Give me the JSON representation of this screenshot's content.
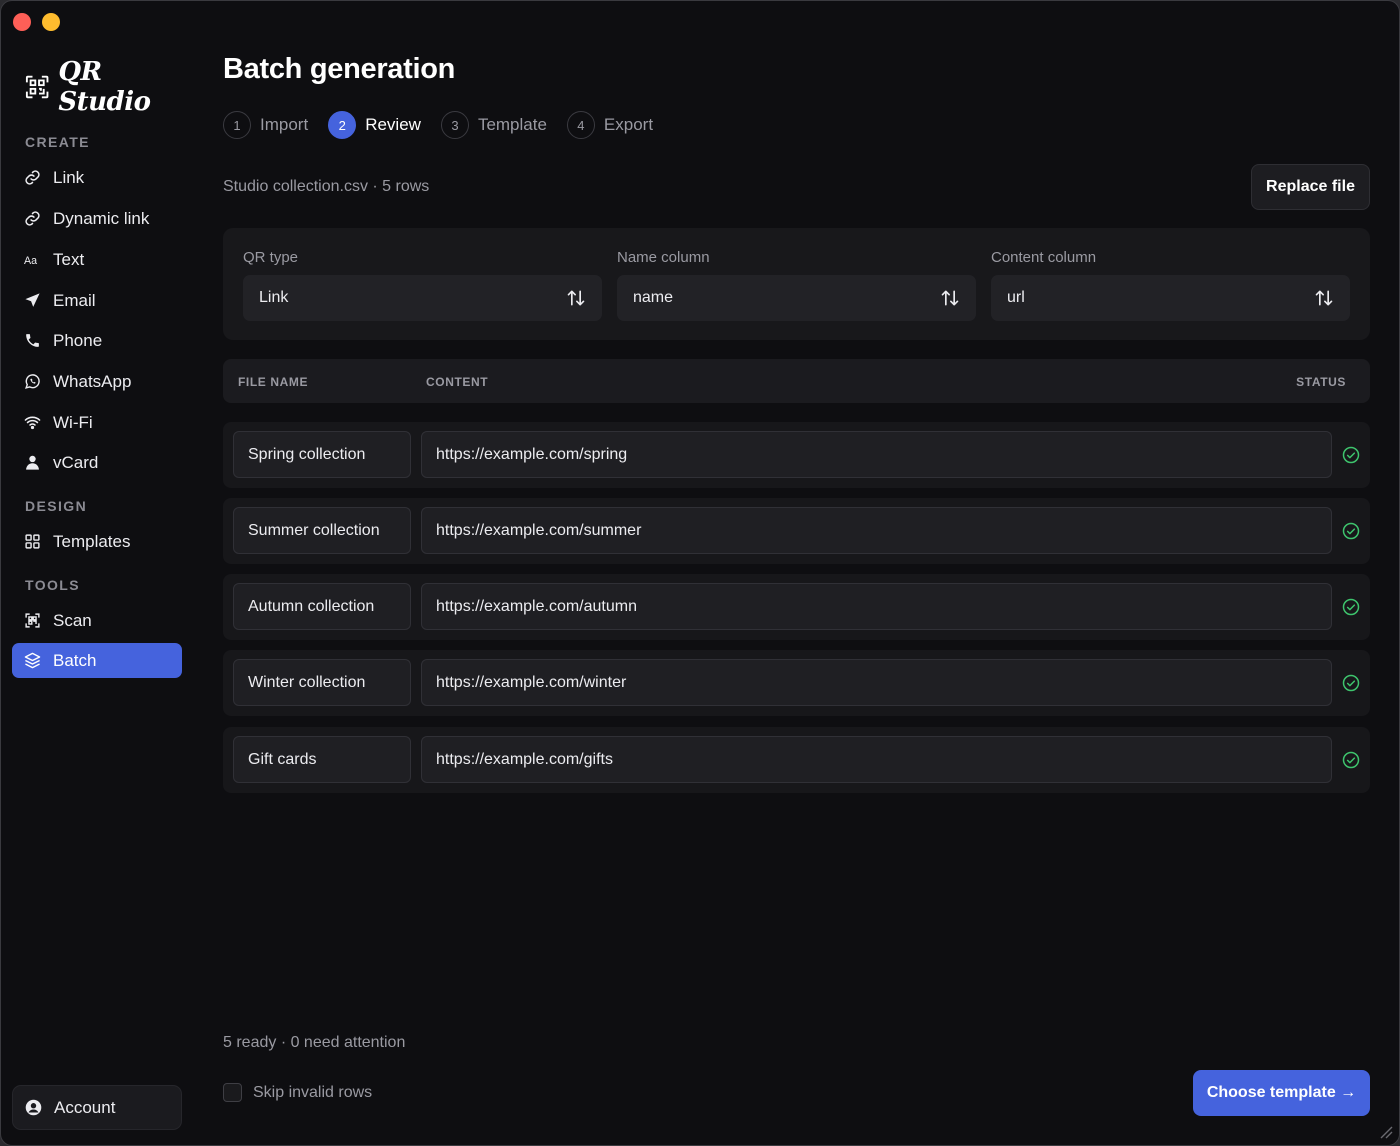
{
  "app": {
    "name": "QR Studio"
  },
  "sidebar": {
    "sections": {
      "create": "CREATE",
      "design": "DESIGN",
      "tools": "TOOLS"
    },
    "items": {
      "link": {
        "label": "Link",
        "icon": "link-icon"
      },
      "dynamic_link": {
        "label": "Dynamic link",
        "icon": "link-icon"
      },
      "text": {
        "label": "Text",
        "icon": "text-icon"
      },
      "email": {
        "label": "Email",
        "icon": "send-icon"
      },
      "phone": {
        "label": "Phone",
        "icon": "phone-icon"
      },
      "whatsapp": {
        "label": "WhatsApp",
        "icon": "whatsapp-icon"
      },
      "wifi": {
        "label": "Wi-Fi",
        "icon": "wifi-icon"
      },
      "vcard": {
        "label": "vCard",
        "icon": "user-icon"
      },
      "templates": {
        "label": "Templates",
        "icon": "grid-icon"
      },
      "scan": {
        "label": "Scan",
        "icon": "scan-icon"
      },
      "batch": {
        "label": "Batch",
        "icon": "layers-icon",
        "active": true
      }
    },
    "account": {
      "label": "Account",
      "icon": "account-circle-icon"
    }
  },
  "page": {
    "title": "Batch generation",
    "steps": [
      {
        "num": "1",
        "label": "Import"
      },
      {
        "num": "2",
        "label": "Review",
        "active": true
      },
      {
        "num": "3",
        "label": "Template"
      },
      {
        "num": "4",
        "label": "Export"
      }
    ],
    "file_meta": "Studio collection.csv · 5 rows",
    "replace_button": "Replace file"
  },
  "config": {
    "qr_type": {
      "label": "QR type",
      "value": "Link"
    },
    "name_column": {
      "label": "Name column",
      "value": "name"
    },
    "content_column": {
      "label": "Content column",
      "value": "url"
    }
  },
  "table": {
    "headers": {
      "file_name": "FILE NAME",
      "content": "CONTENT",
      "status": "STATUS"
    },
    "rows": [
      {
        "name": "Spring collection",
        "content": "https://example.com/spring",
        "status": "ok"
      },
      {
        "name": "Summer collection",
        "content": "https://example.com/summer",
        "status": "ok"
      },
      {
        "name": "Autumn collection",
        "content": "https://example.com/autumn",
        "status": "ok"
      },
      {
        "name": "Winter collection",
        "content": "https://example.com/winter",
        "status": "ok"
      },
      {
        "name": "Gift cards",
        "content": "https://example.com/gifts",
        "status": "ok"
      }
    ]
  },
  "footer": {
    "summary": "5 ready · 0 need attention",
    "skip_invalid": "Skip invalid rows",
    "primary_button": "Choose template →"
  },
  "colors": {
    "accent": "#4563dd",
    "success": "#3ec46d",
    "background": "#0e0e11"
  }
}
